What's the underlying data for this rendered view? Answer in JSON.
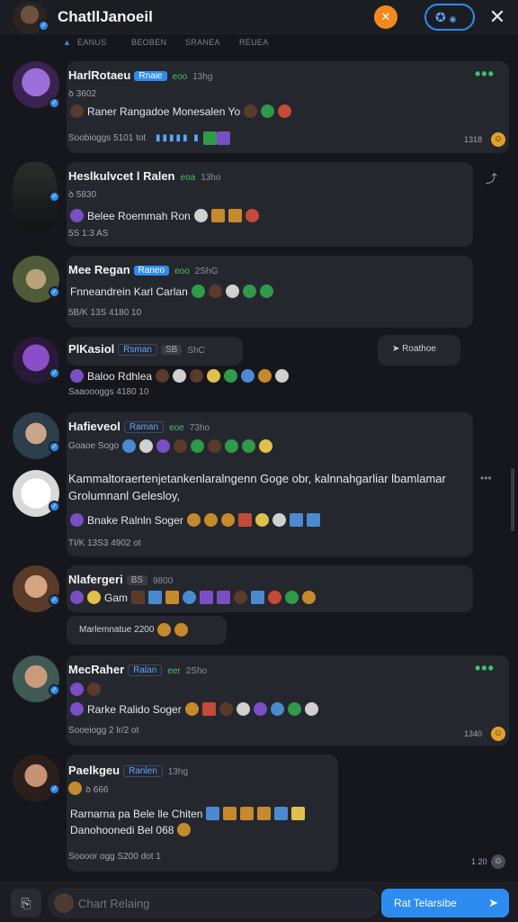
{
  "header": {
    "title": "ChatllJanoeil",
    "orange_icon": "close-circle-icon",
    "pill_icon": "copilot-icon",
    "close_icon": "close-icon"
  },
  "subnav": [
    "EANUS",
    "BEOBEN",
    "SRANEA",
    "REUEA"
  ],
  "messages": [
    {
      "name": "HarlRotaeu",
      "tag": "Rnaie",
      "status": "eoo",
      "time": "13hg",
      "meta": "ꝺ 3602",
      "line": "Raner  Rangadoe Monesalen Yo",
      "footer": "Soobioggs 5101 tot",
      "count": "1318"
    },
    {
      "name": "Heslkulvcet l Ralen",
      "status": "eoa",
      "time": "13ho",
      "meta": "ꝺ 5830",
      "line": "Belee  Roemmah Ron",
      "footer": "5S 1:3 AS"
    },
    {
      "name": "Mee Regan",
      "tag": "Raneo",
      "status": "eoo",
      "time": "2ShG",
      "line": "Fnneandrein  Karl  Carlan",
      "footer": "5B/K 13S 4180 10"
    },
    {
      "name": "PlKasiol",
      "tag": "Rsman",
      "badge": "SB",
      "time": "ShC",
      "line": "Baloo  Rdhlea",
      "footer": "Saaoooggs 4180 10",
      "side_label": "Roathoe"
    },
    {
      "name": "Hafieveol",
      "tag": "Raman",
      "status": "eoe",
      "time": "73ho",
      "meta": "Goaoe Sogo",
      "body": "Kammaltoraertenjetankenlaralngenn Goge obr, kalnnahgarliar lbamlamar Grolumnanl Gelesloy,",
      "line": "Bnake  Ralnln  Soger",
      "footer": "TI/K 13S3 4902 ot"
    },
    {
      "name": "Nlafergeri",
      "badge": "BS",
      "time": "9800",
      "line": "Gam",
      "chip": "Marlemnatue 2200"
    },
    {
      "name": "MecRaher",
      "tag": "Ralan",
      "status": "eer",
      "time": "2Sho",
      "line": "Rarke  Ralido  Soger",
      "footer": "Sooeiogg 2 lr/2 ot",
      "count": "1340"
    },
    {
      "name": "Paelkgeu",
      "tag": "Ranlen",
      "time": "13hg",
      "meta": "ꝺ 666",
      "body": "Rarnarna pa Bele lle Chiten",
      "body2": "Danohoonedi Bel 068",
      "footer": "Soooor ogg S200 dot 1",
      "count": "1 20"
    }
  ],
  "footer": {
    "placeholder": "Chart Relaing",
    "send_label": "Rat Telarsibe",
    "attach_icon": "attach-icon",
    "send_icon": "send-icon"
  }
}
